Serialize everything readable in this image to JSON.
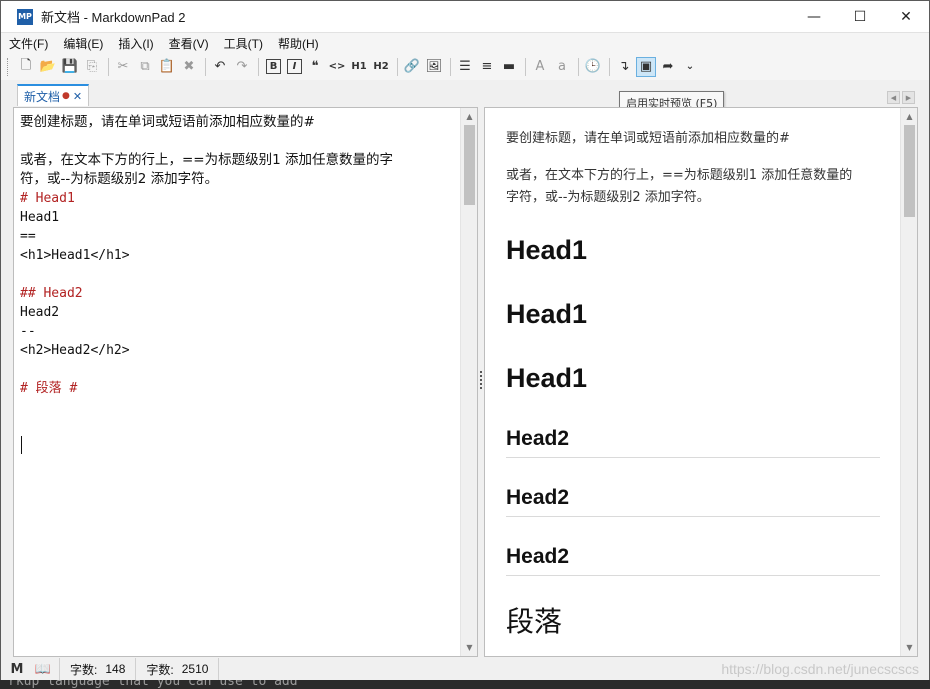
{
  "window": {
    "app_icon_text": "MP",
    "title": "新文档 - MarkdownPad 2",
    "controls": [
      "—",
      "☐",
      "✕"
    ]
  },
  "menu": [
    "文件(F)",
    "编辑(E)",
    "插入(I)",
    "查看(V)",
    "工具(T)",
    "帮助(H)"
  ],
  "toolbar": {
    "icons": [
      "new-document",
      "open-folder",
      "save",
      "save-all",
      "cut",
      "copy",
      "paste",
      "delete",
      "undo",
      "redo",
      "bold",
      "italic",
      "quote",
      "code",
      "h1",
      "h2",
      "link",
      "image",
      "unordered-list",
      "ordered-list",
      "horizontal-rule",
      "uppercase",
      "lowercase",
      "timestamp",
      "line-wrap",
      "live-preview",
      "export"
    ],
    "bold_label": "B",
    "italic_label": "I",
    "h1_label": "H1",
    "h2_label": "H2",
    "upper_label": "A",
    "lower_label": "a",
    "code_label": "<>",
    "quote_label": "❝",
    "overflow_label": "⌄"
  },
  "tab": {
    "label": "新文档",
    "modified_dot": "●",
    "close": "✕"
  },
  "tooltip": "启用实时预览 (F5)",
  "editor": {
    "lines": [
      {
        "text": "要创建标题，请在单词或短语前添加相应数量的#",
        "kind": "cjk"
      },
      {
        "text": "",
        "kind": "plain"
      },
      {
        "text": "或者，在文本下方的行上，==为标题级别1 添加任意数量的字",
        "kind": "cjk"
      },
      {
        "text": "符，或--为标题级别2 添加字符。",
        "kind": "cjk"
      },
      {
        "text": "# Head1",
        "kind": "heading"
      },
      {
        "text": "Head1",
        "kind": "plain"
      },
      {
        "text": "==",
        "kind": "plain"
      },
      {
        "text": "<h1>Head1</h1>",
        "kind": "plain"
      },
      {
        "text": "",
        "kind": "plain"
      },
      {
        "text": "## Head2",
        "kind": "heading"
      },
      {
        "text": "Head2",
        "kind": "plain"
      },
      {
        "text": "--",
        "kind": "plain"
      },
      {
        "text": "<h2>Head2</h2>",
        "kind": "plain"
      },
      {
        "text": "",
        "kind": "plain"
      },
      {
        "text": "# 段落 #",
        "kind": "heading"
      }
    ]
  },
  "preview": {
    "para1": "要创建标题，请在单词或短语前添加相应数量的#",
    "para2_line1": "或者，在文本下方的行上，==为标题级别1 添加任意数量的",
    "para2_line2": "字符，或--为标题级别2 添加字符。",
    "h1_a": "Head1",
    "h1_b": "Head1",
    "h1_c": "Head1",
    "h2_a": "Head2",
    "h2_b": "Head2",
    "h2_c": "Head2",
    "h1_serif": "段落"
  },
  "status": {
    "markdown_icon": "M",
    "preview_icon": "📖",
    "words_label": "字数:",
    "words_value": "148",
    "chars_label": "字数:",
    "chars_value": "2510",
    "watermark": "https://blog.csdn.net/junecscscs"
  },
  "background_text": "rkup language that you can use to add"
}
